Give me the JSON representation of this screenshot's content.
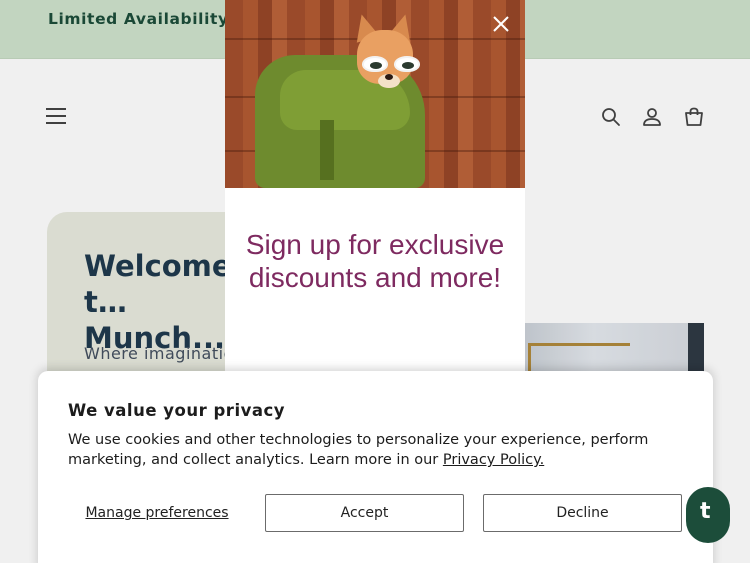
{
  "announcement": {
    "text": "Limited Availability for … s today to secure your"
  },
  "header": {
    "menu_icon": "hamburger-icon",
    "search_icon": "search-icon",
    "account_icon": "account-icon",
    "cart_icon": "cart-icon"
  },
  "hero": {
    "title": "Welcome t… Munch...",
    "subtitle": "Where imaginatio"
  },
  "popup": {
    "heading": "Sign up for exclusive discounts and more!",
    "close_icon": "close-icon"
  },
  "consent": {
    "title": "We value your privacy",
    "text": "We use cookies and other technologies to personalize your experience, perform marketing, and collect analytics. Learn more in our",
    "link": "Privacy Policy.",
    "manage_label": "Manage preferences",
    "accept_label": "Accept",
    "decline_label": "Decline"
  },
  "chat": {
    "label": "t"
  },
  "colors": {
    "announcement_bg": "#cfe3cc",
    "announcement_text": "#1c4d3a",
    "popup_heading": "#7e2a60",
    "hero_card": "#e8eadf"
  }
}
